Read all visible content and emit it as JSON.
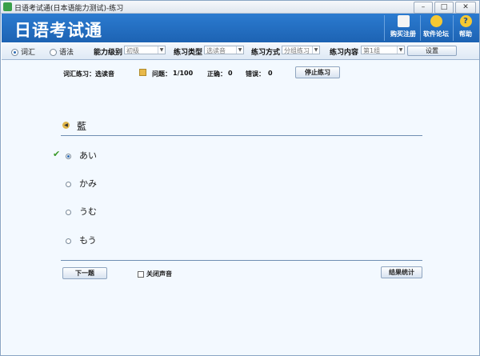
{
  "window": {
    "title": "日语考试通(日本语能力测试)-练习",
    "controls": {
      "minimize": "–",
      "maximize": "□",
      "close": "✕"
    }
  },
  "banner": {
    "app_title": "日语考试通",
    "buttons": [
      {
        "label": "购买注册",
        "icon": "register-icon"
      },
      {
        "label": "软件论坛",
        "icon": "forum-icon"
      },
      {
        "label": "帮助",
        "icon": "help-icon",
        "glyph": "?"
      }
    ]
  },
  "toolbar": {
    "mode_vocab": "词汇",
    "mode_grammar": "语法",
    "level_label": "能力级别",
    "level_value": "初级",
    "type_label": "练习类型",
    "type_value": "选读音",
    "method_label": "练习方式",
    "method_value": "分组练习",
    "content_label": "练习内容",
    "content_value": "第1组",
    "settings_button": "设置"
  },
  "status": {
    "practice": "词汇练习：选读音",
    "question_label": "问题：",
    "question_value": "1/100",
    "correct_label": "正确：",
    "correct_value": "0",
    "wrong_label": "错误：",
    "wrong_value": "0",
    "stop_button": "停止练习"
  },
  "question": {
    "word": "藍",
    "options": [
      "あい",
      "かみ",
      "うむ",
      "もう"
    ],
    "selected_index": 0
  },
  "footer": {
    "next_button": "下一题",
    "mute_label": "关闭声音",
    "stats_button": "结果统计"
  },
  "colors": {
    "banner": "#1d63b3",
    "main_bg": "#f3f9ff",
    "check": "#3a9a2a"
  }
}
